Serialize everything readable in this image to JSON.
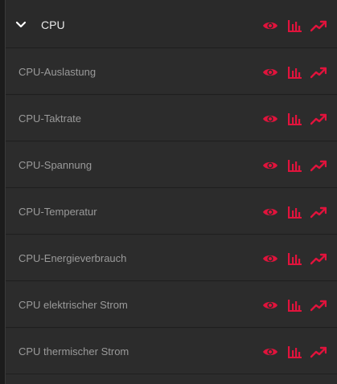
{
  "colors": {
    "accent": "#e1133c",
    "text_primary": "#e8e8e8",
    "text_secondary": "#9a9a9a",
    "row_bg": "#2c2c2c",
    "divider": "#1f1f1f"
  },
  "group": {
    "title": "CPU",
    "expanded": true,
    "icons": [
      "eye-icon",
      "bar-chart-icon",
      "trend-icon"
    ]
  },
  "items": [
    {
      "label": "CPU-Auslastung"
    },
    {
      "label": "CPU-Taktrate"
    },
    {
      "label": "CPU-Spannung"
    },
    {
      "label": "CPU-Temperatur"
    },
    {
      "label": "CPU-Energieverbrauch"
    },
    {
      "label": "CPU elektrischer Strom"
    },
    {
      "label": "CPU thermischer Strom"
    }
  ]
}
